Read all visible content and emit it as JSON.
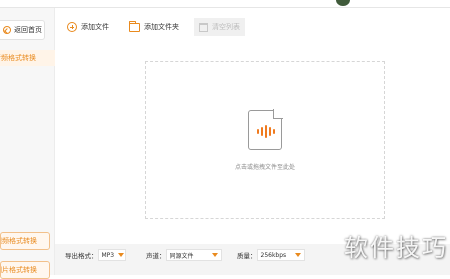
{
  "titlebar": {
    "text": ""
  },
  "sidebar": {
    "back_label": "返回首页",
    "items": [
      {
        "label": "音频格式转换"
      }
    ],
    "bottom_items": [
      {
        "label": "视频格式转换"
      },
      {
        "label": "图片格式转换"
      }
    ]
  },
  "toolbar": {
    "add_file": "添加文件",
    "add_folder": "添加文件夹",
    "clear": "清空列表"
  },
  "dropzone": {
    "hint": "点击或拖拽文件至此处"
  },
  "settings": {
    "format_label": "导出格式：",
    "format_value": "MP3",
    "channel_label": "声道：",
    "channel_value": "同源文件",
    "quality_label": "质量：",
    "quality_value": "256kbps"
  },
  "watermark": "软件技巧",
  "colors": {
    "accent": "#e98a1e",
    "bar": "#f07a1e"
  }
}
